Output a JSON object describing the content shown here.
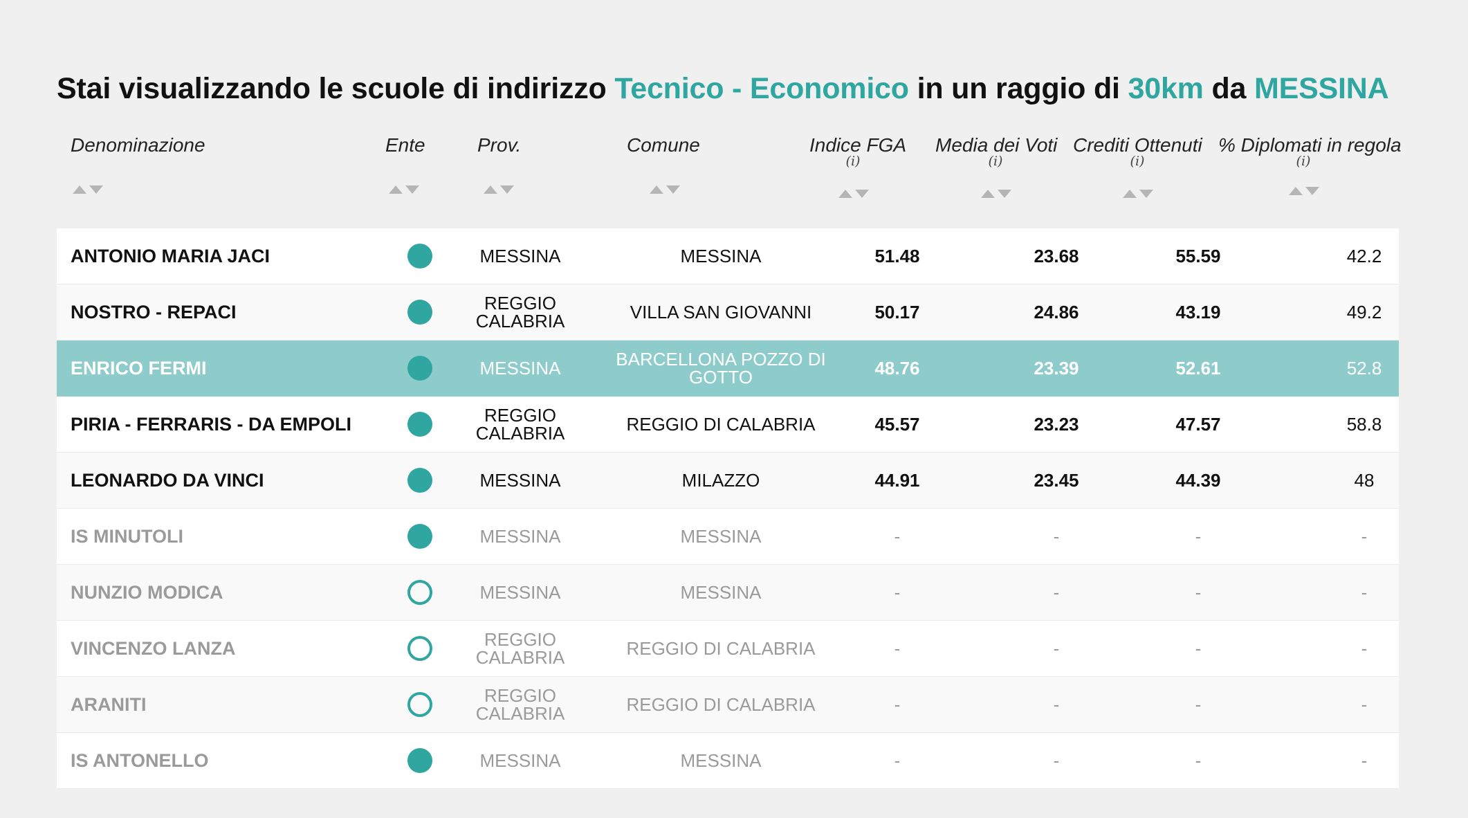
{
  "headline": {
    "prefix": "Stai visualizzando le scuole di indirizzo ",
    "indirizzo": "Tecnico - Economico",
    "middle": " in un raggio di ",
    "raggio": "30km",
    "connector": " da ",
    "citta": "MESSINA"
  },
  "accent_color": "#2fa6a0",
  "highlight_row_color": "#8ecccb",
  "columns": {
    "denominazione": "Denominazione",
    "ente": "Ente",
    "prov": "Prov.",
    "comune": "Comune",
    "indice_fga": "Indice FGA",
    "media_voti": "Media dei Voti",
    "crediti": "Crediti Ottenuti",
    "diplomati": "% Diplomati in regola",
    "info_mark": "(i)"
  },
  "rows": [
    {
      "name": "ANTONIO MARIA JACI",
      "ente": "filled",
      "prov_1": "MESSINA",
      "prov_2": "",
      "comune_1": "MESSINA",
      "comune_2": "",
      "fga": "51.48",
      "media": "23.68",
      "crediti": "55.59",
      "diplomati": "42.2"
    },
    {
      "name": "NOSTRO - REPACI",
      "ente": "filled",
      "prov_1": "REGGIO",
      "prov_2": "CALABRIA",
      "comune_1": "VILLA SAN GIOVANNI",
      "comune_2": "",
      "fga": "50.17",
      "media": "24.86",
      "crediti": "43.19",
      "diplomati": "49.2"
    },
    {
      "name": "ENRICO FERMI",
      "ente": "filled",
      "prov_1": "MESSINA",
      "prov_2": "",
      "comune_1": "BARCELLONA POZZO DI",
      "comune_2": "GOTTO",
      "fga": "48.76",
      "media": "23.39",
      "crediti": "52.61",
      "diplomati": "52.8"
    },
    {
      "name": "PIRIA - FERRARIS - DA EMPOLI",
      "ente": "filled",
      "prov_1": "REGGIO",
      "prov_2": "CALABRIA",
      "comune_1": "REGGIO DI CALABRIA",
      "comune_2": "",
      "fga": "45.57",
      "media": "23.23",
      "crediti": "47.57",
      "diplomati": "58.8"
    },
    {
      "name": "LEONARDO DA VINCI",
      "ente": "filled",
      "prov_1": "MESSINA",
      "prov_2": "",
      "comune_1": "MILAZZO",
      "comune_2": "",
      "fga": "44.91",
      "media": "23.45",
      "crediti": "44.39",
      "diplomati": "48"
    },
    {
      "name": "IS MINUTOLI",
      "ente": "filled",
      "prov_1": "MESSINA",
      "prov_2": "",
      "comune_1": "MESSINA",
      "comune_2": "",
      "fga": "-",
      "media": "-",
      "crediti": "-",
      "diplomati": "-"
    },
    {
      "name": "NUNZIO MODICA",
      "ente": "hollow",
      "prov_1": "MESSINA",
      "prov_2": "",
      "comune_1": "MESSINA",
      "comune_2": "",
      "fga": "-",
      "media": "-",
      "crediti": "-",
      "diplomati": "-"
    },
    {
      "name": "VINCENZO LANZA",
      "ente": "hollow",
      "prov_1": "REGGIO",
      "prov_2": "CALABRIA",
      "comune_1": "REGGIO DI CALABRIA",
      "comune_2": "",
      "fga": "-",
      "media": "-",
      "crediti": "-",
      "diplomati": "-"
    },
    {
      "name": "ARANITI",
      "ente": "hollow",
      "prov_1": "REGGIO",
      "prov_2": "CALABRIA",
      "comune_1": "REGGIO DI CALABRIA",
      "comune_2": "",
      "fga": "-",
      "media": "-",
      "crediti": "-",
      "diplomati": "-"
    },
    {
      "name": "IS ANTONELLO",
      "ente": "filled",
      "prov_1": "MESSINA",
      "prov_2": "",
      "comune_1": "MESSINA",
      "comune_2": "",
      "fga": "-",
      "media": "-",
      "crediti": "-",
      "diplomati": "-"
    }
  ]
}
